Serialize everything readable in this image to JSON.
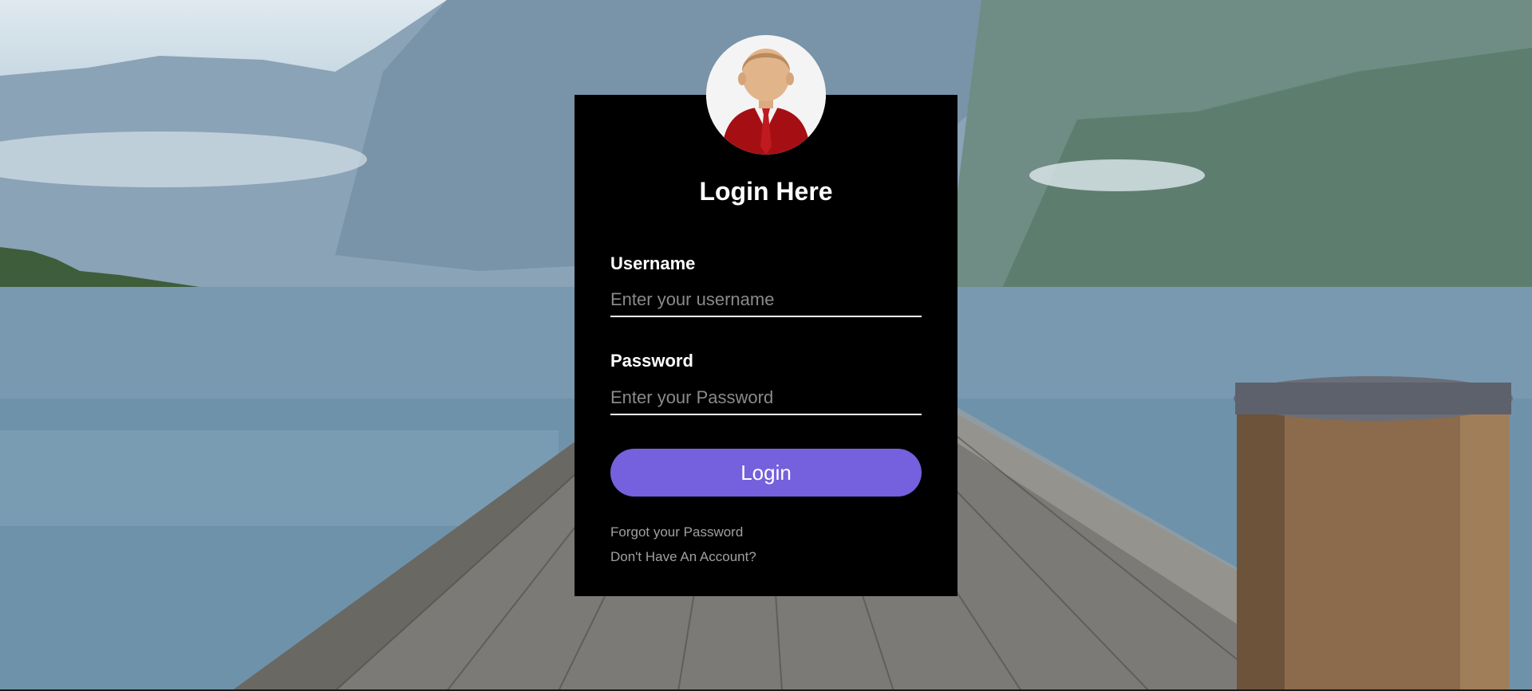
{
  "form": {
    "title": "Login Here",
    "username_label": "Username",
    "username_placeholder": "Enter your username",
    "username_value": "",
    "password_label": "Password",
    "password_placeholder": "Enter your Password",
    "password_value": "",
    "submit_label": "Login",
    "forgot_link": "Forgot your Password",
    "signup_link": "Don't Have An Account?"
  },
  "colors": {
    "card_background": "#000000",
    "button_accent": "#7560dd",
    "text_primary": "#ffffff",
    "link_text": "#a0a0a0"
  },
  "icons": {
    "avatar": "user-avatar-icon"
  }
}
